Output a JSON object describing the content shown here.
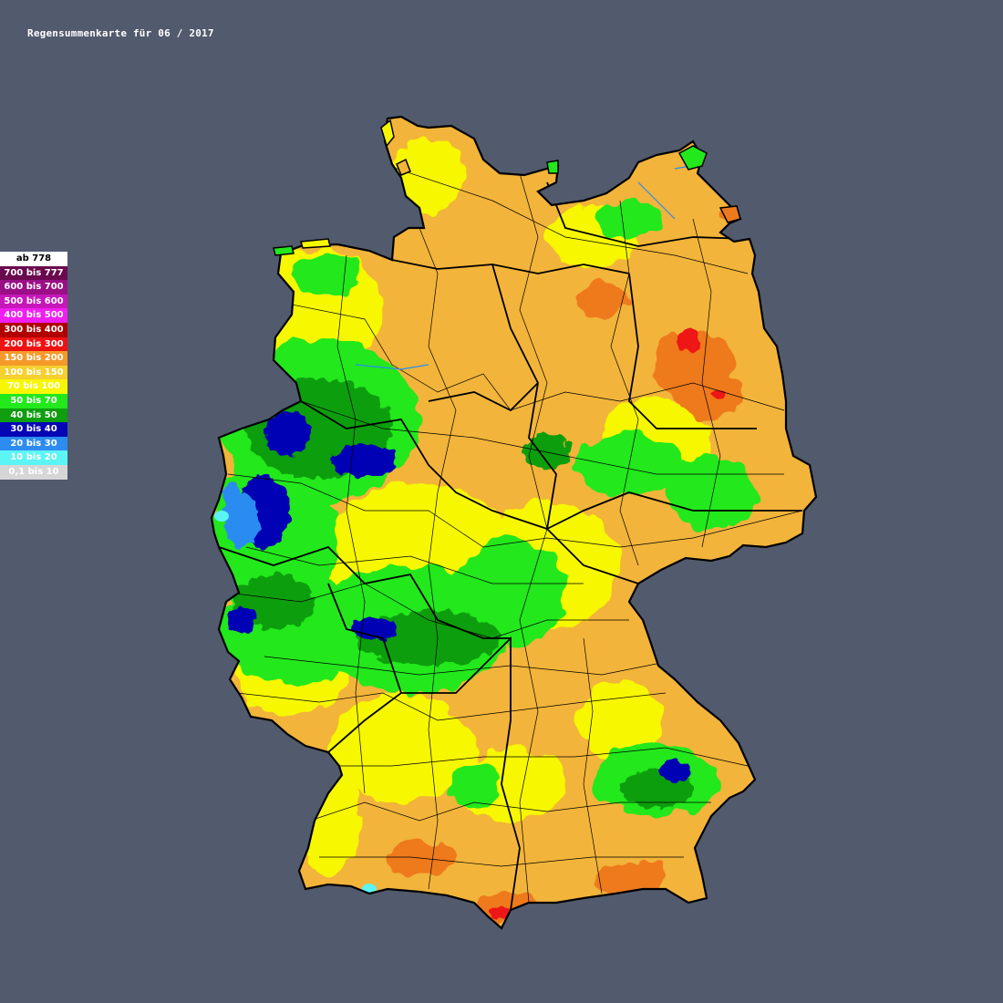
{
  "title": "Regensummenkarte für 06 / 2017",
  "legend": [
    {
      "label": "ab 778",
      "color": "#ffffff",
      "text": "#000000"
    },
    {
      "label": "700 bis 777",
      "color": "#6a0a4e",
      "text": "#ffffff"
    },
    {
      "label": "600 bis 700",
      "color": "#9a0f86",
      "text": "#ffffff"
    },
    {
      "label": "500 bis 600",
      "color": "#c617b8",
      "text": "#ffffff"
    },
    {
      "label": "400 bis 500",
      "color": "#f01ef0",
      "text": "#ffffff"
    },
    {
      "label": "300 bis 400",
      "color": "#b00000",
      "text": "#ffffff"
    },
    {
      "label": "200 bis 300",
      "color": "#ee1212",
      "text": "#ffffff"
    },
    {
      "label": "150 bis 200",
      "color": "#f59a2a",
      "text": "#ffffff"
    },
    {
      "label": "100 bis 150",
      "color": "#f5d030",
      "text": "#ffffff"
    },
    {
      "label": "70 bis 100",
      "color": "#f7f700",
      "text": "#ffffff"
    },
    {
      "label": "50 bis 70",
      "color": "#22e81c",
      "text": "#ffffff"
    },
    {
      "label": "40 bis 50",
      "color": "#0e9e0e",
      "text": "#ffffff"
    },
    {
      "label": "30 bis 40",
      "color": "#0606b4",
      "text": "#ffffff"
    },
    {
      "label": "20 bis 30",
      "color": "#2c8cf0",
      "text": "#ffffff"
    },
    {
      "label": "10 bis 20",
      "color": "#5cf4f4",
      "text": "#ffffff"
    },
    {
      "label": "0,1 bis 10",
      "color": "#d6d6d6",
      "text": "#ffffff"
    }
  ],
  "colors": {
    "background": "#525a6d",
    "base_orange": "#f2b43a",
    "yellow": "#f7f700",
    "green": "#22e81c",
    "dark_green": "#0e9e0e",
    "blue": "#0606b4",
    "light_blue": "#2c8cf0",
    "cyan": "#5cf4f4",
    "red": "#ee1212",
    "dark_orange": "#ee7a1e",
    "border": "#000000"
  }
}
